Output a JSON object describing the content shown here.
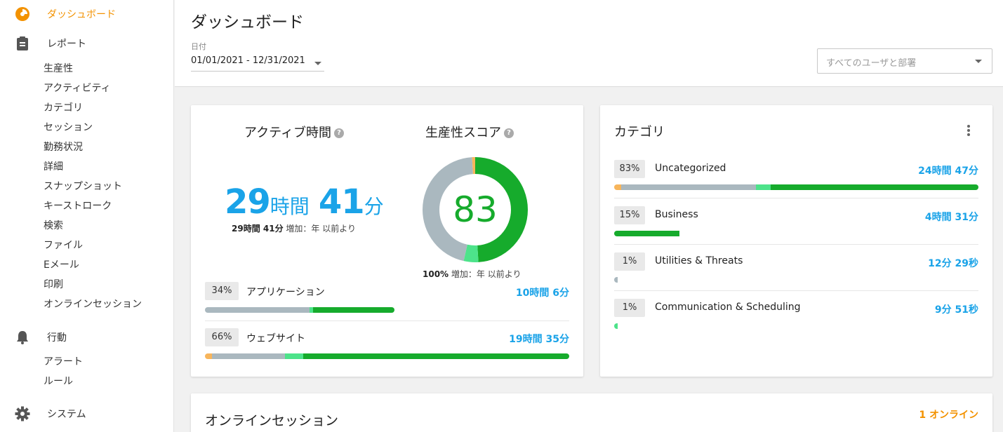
{
  "colors": {
    "accent": "#f39200",
    "blue": "#1aa3e8",
    "green": "#16ab2c",
    "lightgreen": "#4de38a",
    "grey": "#aab8bf",
    "orange": "#f7b55c"
  },
  "sidebar": {
    "dashboard": "ダッシュボード",
    "reports": "レポート",
    "report_items": [
      "生産性",
      "アクティビティ",
      "カテゴリ",
      "セッション",
      "勤務状況",
      "詳細",
      "スナップショット",
      "キーストローク",
      "検索",
      "ファイル",
      "Eメール",
      "印刷",
      "オンラインセッション"
    ],
    "behavior": "行動",
    "behavior_items": [
      "アラート",
      "ルール"
    ],
    "system": "システム"
  },
  "header": {
    "title": "ダッシュボード",
    "date_label": "日付",
    "date_value": "01/01/2021 - 12/31/2021",
    "user_placeholder": "すべてのユーザと部署"
  },
  "active": {
    "title": "アクティブ時間",
    "hours": "29",
    "hours_unit": "時間",
    "minutes": "41",
    "minutes_unit": "分",
    "note_value": "29時間 41分",
    "note_text": "増加：年 以前より",
    "rows": [
      {
        "pct": "34%",
        "label": "アプリケーション",
        "time": "10時間 6分",
        "segments": [
          {
            "color": "#aab8bf",
            "frac": 0.55
          },
          {
            "color": "#4de38a",
            "frac": 0.02
          },
          {
            "color": "#16ab2c",
            "frac": 0.43
          }
        ]
      },
      {
        "pct": "66%",
        "label": "ウェブサイト",
        "time": "19時間 35分",
        "segments": [
          {
            "color": "#f7b55c",
            "frac": 0.02
          },
          {
            "color": "#aab8bf",
            "frac": 0.2
          },
          {
            "color": "#4de38a",
            "frac": 0.05
          },
          {
            "color": "#16ab2c",
            "frac": 0.73
          }
        ]
      }
    ]
  },
  "productivity": {
    "title": "生産性スコア",
    "score": "83",
    "note_value": "100%",
    "note_text": "増加：年 以前より",
    "segments": [
      {
        "color": "#16ab2c",
        "frac": 0.49
      },
      {
        "color": "#4de38a",
        "frac": 0.045
      },
      {
        "color": "#aab8bf",
        "frac": 0.455
      },
      {
        "color": "#f7b55c",
        "frac": 0.01
      }
    ]
  },
  "categories": {
    "title": "カテゴリ",
    "rows": [
      {
        "pct": "83%",
        "label": "Uncategorized",
        "time": "24時間 47分",
        "segments": [
          {
            "color": "#f7b55c",
            "frac": 0.02
          },
          {
            "color": "#aab8bf",
            "frac": 0.37
          },
          {
            "color": "#4de38a",
            "frac": 0.04
          },
          {
            "color": "#16ab2c",
            "frac": 0.57
          }
        ]
      },
      {
        "pct": "15%",
        "label": "Business",
        "time": "4時間 31分",
        "segments": [
          {
            "color": "#16ab2c",
            "frac": 0.18
          }
        ]
      },
      {
        "pct": "1%",
        "label": "Utilities & Threats",
        "time": "12分 29秒",
        "segments": [
          {
            "color": "#aab8bf",
            "frac": 0.01
          }
        ]
      },
      {
        "pct": "1%",
        "label": "Communication & Scheduling",
        "time": "9分 51秒",
        "segments": [
          {
            "color": "#4de38a",
            "frac": 0.01
          }
        ]
      }
    ]
  },
  "online": {
    "title": "オンラインセッション",
    "count": "1 オンライン"
  }
}
